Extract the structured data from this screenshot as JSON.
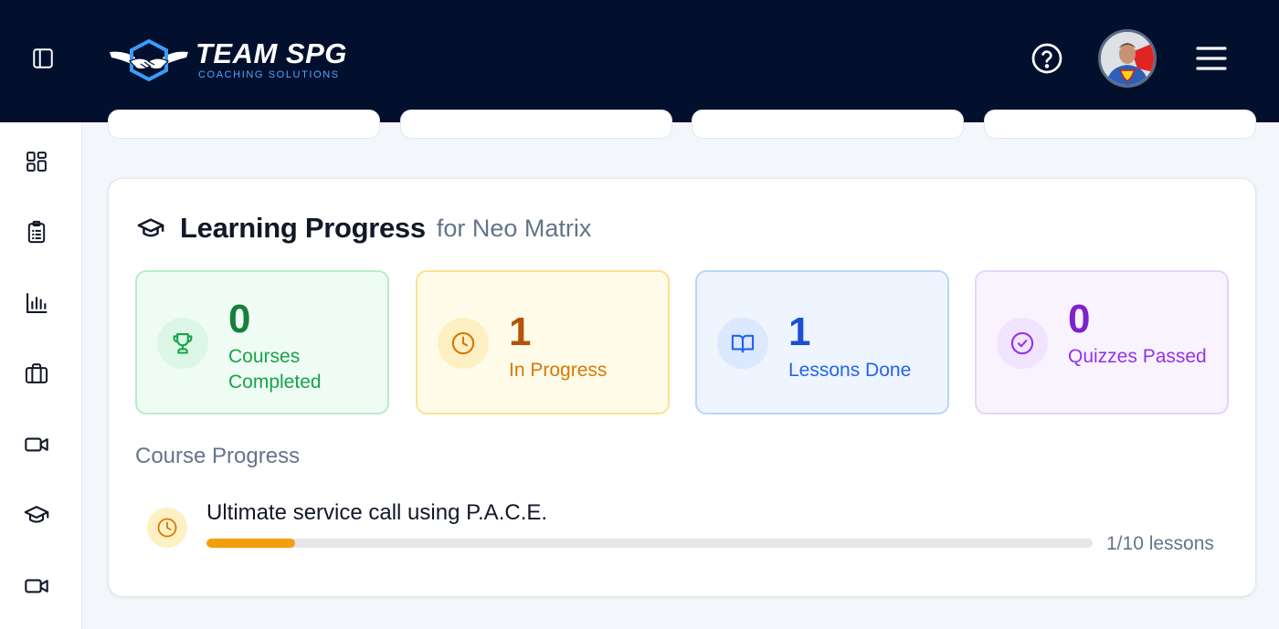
{
  "header": {
    "brand_name": "TEAM SPG",
    "brand_tagline": "COACHING SOLUTIONS",
    "icons": [
      "sidebar-toggle-icon",
      "help-icon",
      "hamburger-menu-icon"
    ],
    "background_color": "#02102e"
  },
  "sidebar": {
    "items": [
      {
        "icon": "dashboard-icon"
      },
      {
        "icon": "clipboard-list-icon"
      },
      {
        "icon": "bar-chart-icon"
      },
      {
        "icon": "briefcase-icon"
      },
      {
        "icon": "video-camera-icon"
      },
      {
        "icon": "graduation-cap-icon"
      },
      {
        "icon": "video-camera-icon"
      }
    ]
  },
  "learning_progress": {
    "title": "Learning Progress",
    "subtitle": "for Neo Matrix",
    "stats": [
      {
        "value": "0",
        "label": "Courses Completed",
        "icon": "trophy-icon",
        "color": "#15803d"
      },
      {
        "value": "1",
        "label": "In Progress",
        "icon": "clock-icon",
        "color": "#b45309"
      },
      {
        "value": "1",
        "label": "Lessons Done",
        "icon": "open-book-icon",
        "color": "#1d4ed8"
      },
      {
        "value": "0",
        "label": "Quizzes Passed",
        "icon": "check-circle-icon",
        "color": "#7e22ce"
      }
    ],
    "course_section_heading": "Course Progress",
    "courses": [
      {
        "title": "Ultimate service call using P.A.C.E.",
        "progress_text": "1/10 lessons",
        "progress_fraction": 0.1,
        "icon": "clock-icon",
        "bar_color": "#f59e0b"
      }
    ]
  }
}
